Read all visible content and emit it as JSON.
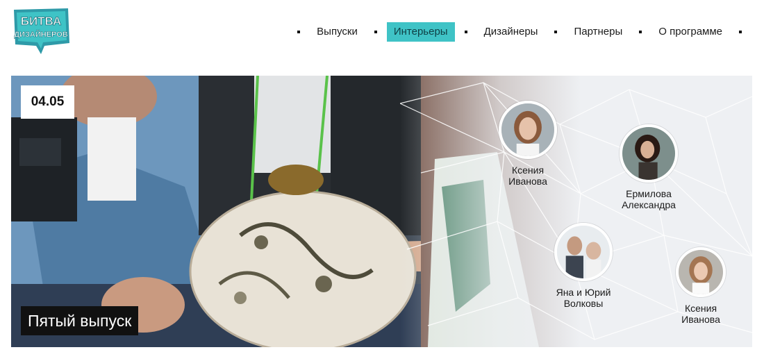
{
  "brand": {
    "logo_text_line1": "БИТВА",
    "logo_text_line2": "ДИЗАЙНЕРОВ",
    "accent": "#3fc3c6"
  },
  "nav": {
    "items": [
      {
        "label": "Выпуски",
        "active": false
      },
      {
        "label": "Интерьеры",
        "active": true
      },
      {
        "label": "Дизайнеры",
        "active": false
      },
      {
        "label": "Партнеры",
        "active": false
      },
      {
        "label": "О программе",
        "active": false
      }
    ]
  },
  "hero": {
    "date": "04.05",
    "episode_title": "Пятый выпуск",
    "designers": [
      {
        "line1": "Ксения",
        "line2": "Иванова"
      },
      {
        "line1": "Ермилова",
        "line2": "Александра"
      },
      {
        "line1": "Яна и Юрий",
        "line2": "Волковы"
      },
      {
        "line1": "Ксения",
        "line2": "Иванова"
      }
    ]
  }
}
